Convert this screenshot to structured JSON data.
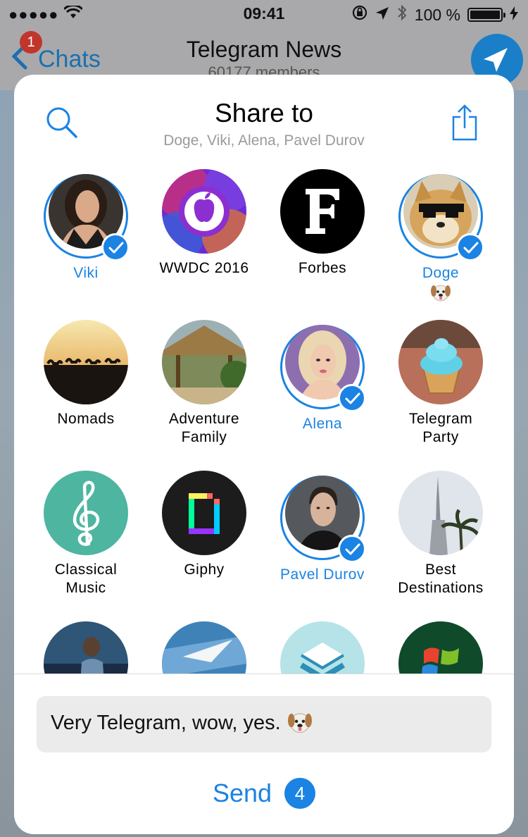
{
  "status_bar": {
    "signal": "●●●●●",
    "time": "09:41",
    "battery_text": "100 %"
  },
  "background_chat": {
    "back_label": "Chats",
    "unread_badge": "1",
    "title": "Telegram News",
    "subtitle": "60177 members"
  },
  "share_sheet": {
    "title": "Share to",
    "subtitle": "Doge, Viki, Alena, Pavel Durov",
    "contacts": [
      {
        "name": "Viki",
        "selected": true
      },
      {
        "name": "WWDC 2016",
        "selected": false
      },
      {
        "name": "Forbes",
        "selected": false
      },
      {
        "name": "Doge",
        "selected": true,
        "emoji": "dog-face"
      },
      {
        "name": "Nomads",
        "selected": false
      },
      {
        "name": "Adventure Family",
        "line1": "Adventure",
        "line2": "Family",
        "selected": false
      },
      {
        "name": "Alena",
        "selected": true
      },
      {
        "name": "Telegram Party",
        "line1": "Telegram",
        "line2": "Party",
        "selected": false
      },
      {
        "name": "Classical Music",
        "line1": "Classical",
        "line2": "Music",
        "selected": false
      },
      {
        "name": "Giphy",
        "selected": false
      },
      {
        "name": "Pavel Durov",
        "selected": true
      },
      {
        "name": "Best Destinations",
        "line1": "Best",
        "line2": "Destinations",
        "selected": false
      }
    ],
    "message": "Very Telegram, wow, yes.",
    "send_label": "Send",
    "send_count": "4"
  },
  "colors": {
    "accent": "#1a83e3",
    "badge": "#c0362c"
  }
}
